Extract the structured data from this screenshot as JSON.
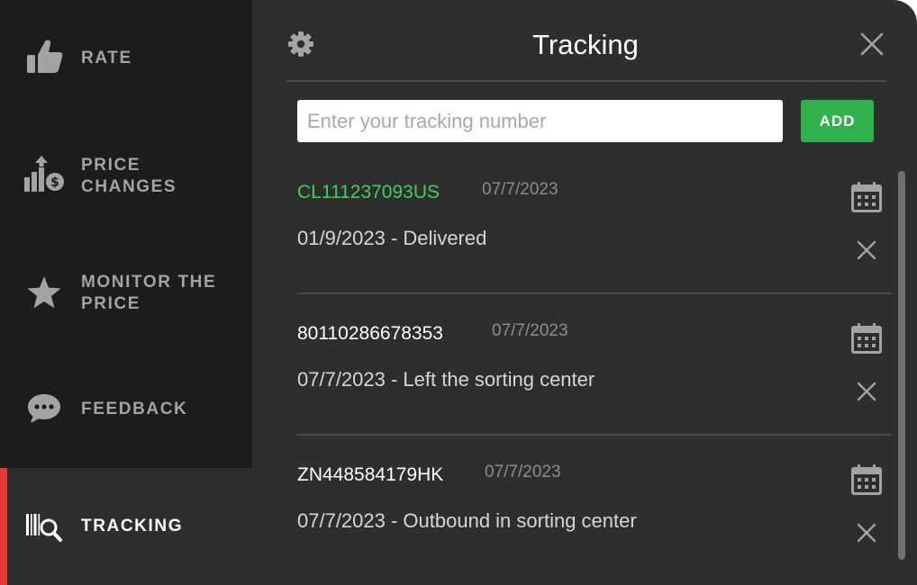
{
  "sidebar": {
    "items": [
      {
        "label": "RATE",
        "icon": "thumbs-up-icon"
      },
      {
        "label": "PRICE\nCHANGES",
        "icon": "price-changes-icon"
      },
      {
        "label": "MONITOR THE\nPRICE",
        "icon": "star-icon"
      },
      {
        "label": "FEEDBACK",
        "icon": "chat-bubble-icon"
      },
      {
        "label": "TRACKING",
        "icon": "barcode-search-icon",
        "active": true
      }
    ]
  },
  "header": {
    "title": "Tracking",
    "settings_icon": "gear-icon",
    "close_icon": "close-icon"
  },
  "search": {
    "placeholder": "Enter your tracking number",
    "value": "",
    "add_label": "ADD"
  },
  "entries": [
    {
      "number": "CL111237093US",
      "date": "07/7/2023",
      "status": "01/9/2023 - Delivered",
      "number_color": "#3ecf5a"
    },
    {
      "number": "80110286678353",
      "date": "07/7/2023",
      "status": "07/7/2023 - Left the sorting center",
      "number_color": "#ffffff"
    },
    {
      "number": "ZN448584179HK",
      "date": "07/7/2023",
      "status": "07/7/2023 - Outbound in sorting center",
      "number_color": "#ffffff"
    }
  ],
  "colors": {
    "accent_green": "#2fb24c",
    "active_indicator": "#e53935",
    "delivered_green": "#3ecf5a"
  }
}
